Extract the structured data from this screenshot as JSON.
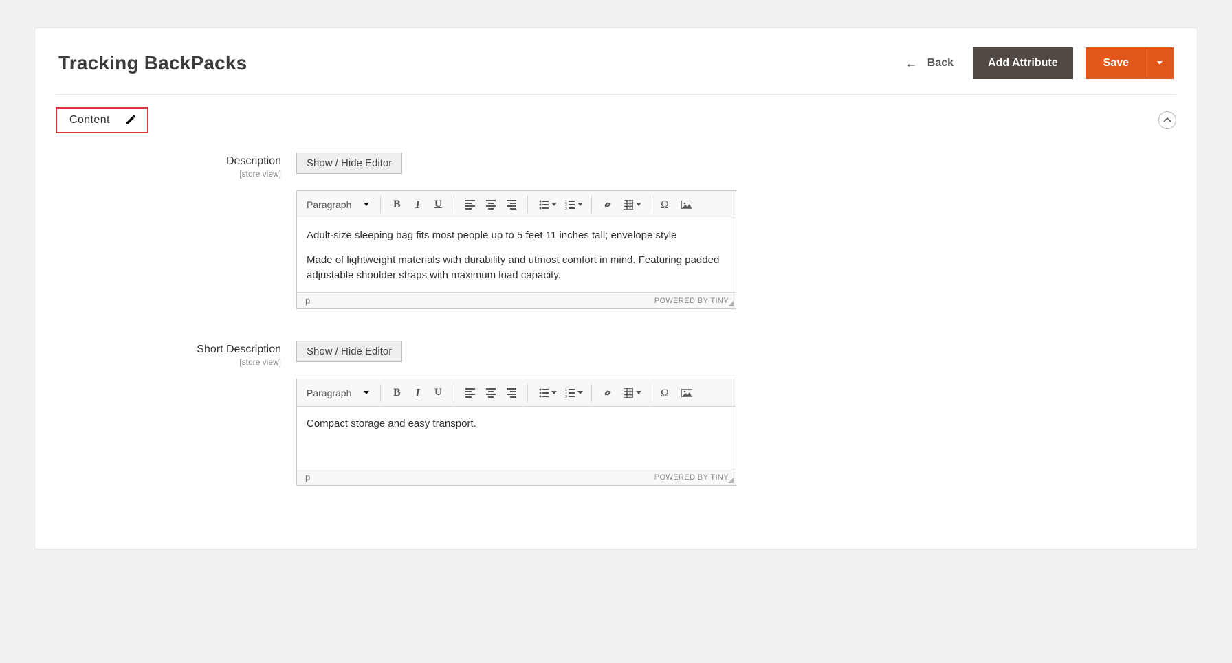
{
  "header": {
    "title": "Tracking BackPacks",
    "back_label": "Back",
    "add_attribute_label": "Add Attribute",
    "save_label": "Save"
  },
  "section": {
    "title": "Content"
  },
  "description": {
    "label": "Description",
    "scope": "[store view]",
    "toggle_label": "Show / Hide Editor",
    "format_label": "Paragraph",
    "body_p1": "Adult-size sleeping bag fits most people up to 5 feet 11 inches tall; envelope style",
    "body_p2": "Made of lightweight materials with durability and utmost comfort in mind. Featuring padded adjustable shoulder straps with maximum load capacity.",
    "path": "p",
    "powered": "POWERED BY TINY"
  },
  "short_description": {
    "label": "Short Description",
    "scope": "[store view]",
    "toggle_label": "Show / Hide Editor",
    "format_label": "Paragraph",
    "body_p1": "Compact storage and easy transport.",
    "path": "p",
    "powered": "POWERED BY TINY"
  }
}
